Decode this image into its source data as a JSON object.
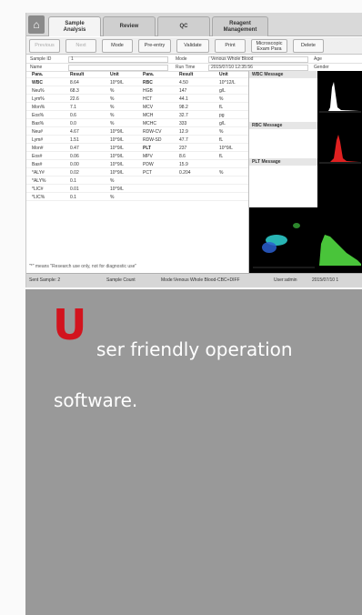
{
  "tabs": [
    {
      "label": "Sample Analysis",
      "line1": "Sample",
      "line2": "Analysis",
      "active": true
    },
    {
      "label": "Review",
      "line1": "Review",
      "line2": "",
      "active": false
    },
    {
      "label": "QC",
      "line1": "QC",
      "line2": "",
      "active": false
    },
    {
      "label": "Reagent Management",
      "line1": "Reagent",
      "line2": "Management",
      "active": false
    }
  ],
  "toolbar": {
    "previous": "Previous",
    "next": "Next",
    "mode": "Mode",
    "pre_entry": "Pre-entry",
    "validate": "Validate",
    "print": "Print",
    "microscopic_line1": "Microscopic",
    "microscopic_line2": "Exam Para",
    "delete": "Delete"
  },
  "sample_info": {
    "sample_id_label": "Sample ID",
    "sample_id_value": "1",
    "mode_label": "Mode",
    "mode_value": "Venous Whole Blood",
    "age_label": "Age",
    "name_label": "Name",
    "run_time_label": "Run Time",
    "run_time_value": "2015/07/10 12:35:56",
    "gender_label": "Gender"
  },
  "table_headers": {
    "para": "Para.",
    "result": "Result",
    "unit": "Unit"
  },
  "left_params": [
    {
      "para": "WBC",
      "result": "8.64",
      "unit": "10^9/L",
      "bold": true
    },
    {
      "para": "Neu%",
      "result": "68.3",
      "unit": "%",
      "bold": false
    },
    {
      "para": "Lym%",
      "result": "22.6",
      "unit": "%",
      "bold": false
    },
    {
      "para": "Mon%",
      "result": "7.1",
      "unit": "%",
      "bold": false
    },
    {
      "para": "Eos%",
      "result": "0.6",
      "unit": "%",
      "bold": false
    },
    {
      "para": "Bas%",
      "result": "0.0",
      "unit": "%",
      "bold": false
    },
    {
      "para": "Neu#",
      "result": "4.67",
      "unit": "10^9/L",
      "bold": false
    },
    {
      "para": "Lym#",
      "result": "1.51",
      "unit": "10^9/L",
      "bold": false
    },
    {
      "para": "Mon#",
      "result": "0.47",
      "unit": "10^9/L",
      "bold": false
    },
    {
      "para": "Eos#",
      "result": "0.06",
      "unit": "10^9/L",
      "bold": false
    },
    {
      "para": "Bas#",
      "result": "0.00",
      "unit": "10^9/L",
      "bold": false
    },
    {
      "para": "*ALY#",
      "result": "0.02",
      "unit": "10^9/L",
      "bold": false
    },
    {
      "para": "*ALY%",
      "result": "0.1",
      "unit": "%",
      "bold": false
    },
    {
      "para": "*LIC#",
      "result": "0.01",
      "unit": "10^9/L",
      "bold": false
    },
    {
      "para": "*LIC%",
      "result": "0.1",
      "unit": "%",
      "bold": false
    }
  ],
  "right_params": [
    {
      "para": "RBC",
      "result": "4.50",
      "unit": "10^12/L",
      "bold": true
    },
    {
      "para": "HGB",
      "result": "147",
      "unit": "g/L",
      "bold": false
    },
    {
      "para": "HCT",
      "result": "44.1",
      "unit": "%",
      "bold": false
    },
    {
      "para": "MCV",
      "result": "98.2",
      "unit": "fL",
      "bold": false
    },
    {
      "para": "MCH",
      "result": "32.7",
      "unit": "pg",
      "bold": false
    },
    {
      "para": "MCHC",
      "result": "333",
      "unit": "g/L",
      "bold": false
    },
    {
      "para": "RDW-CV",
      "result": "12.9",
      "unit": "%",
      "bold": false
    },
    {
      "para": "RDW-SD",
      "result": "47.7",
      "unit": "fL",
      "bold": false
    },
    {
      "para": "PLT",
      "result": "237",
      "unit": "10^9/L",
      "bold": true
    },
    {
      "para": "MPV",
      "result": "8.6",
      "unit": "fL",
      "bold": false
    },
    {
      "para": "PDW",
      "result": "15.9",
      "unit": "",
      "bold": false
    },
    {
      "para": "PCT",
      "result": "0.204",
      "unit": "%",
      "bold": false
    }
  ],
  "messages": {
    "wbc": "WBC Message",
    "rbc": "RBC Message",
    "plt": "PLT Message"
  },
  "footnote": "\"*\" means \"Research use only, not for diagnostic use\"",
  "status": {
    "sent_sample": "Sent Sample: 2",
    "sample_count": "Sample Count",
    "mode": "Mode:Venous Whole Blood-CBC+DIFF",
    "user": "User:admin",
    "datetime": "2015/07/10 1"
  },
  "promo": {
    "big_letter": "U",
    "line1": "ser friendly operation",
    "line2": "software."
  },
  "colors": {
    "accent_red": "#d2141e",
    "panel_gray": "#999999",
    "rbc_histogram": "#e02020",
    "plt_histogram": "#49c43a",
    "scatter_cyan": "#2fd3d3"
  }
}
